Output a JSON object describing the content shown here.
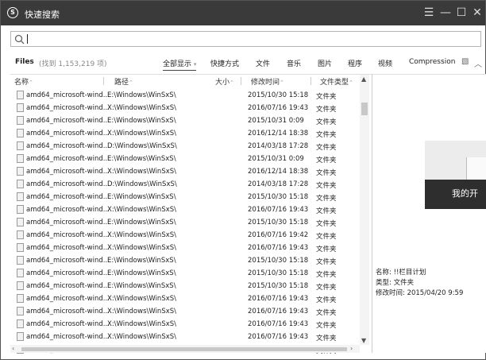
{
  "window": {
    "title": "快速搜索",
    "logo_glyph": "S",
    "menu_icon": "☰",
    "min_icon": "—",
    "max_icon": "☐",
    "close_icon": "✕"
  },
  "search": {
    "value": "",
    "placeholder": ""
  },
  "filters": {
    "files_label": "Files",
    "files_count": "(找到 1,153,219 项)",
    "items": [
      "全部显示",
      "快捷方式",
      "文件",
      "音乐",
      "图片",
      "程序",
      "视频",
      "Compression"
    ],
    "active": "全部显示",
    "active_arrow": "▾"
  },
  "table": {
    "headers": {
      "name": "名称",
      "path": "路径",
      "size": "大小",
      "date": "修改时间",
      "type": "文件类型"
    },
    "rows": [
      {
        "name": "amd64_microsoft-wind...",
        "path": "E:\\Windows\\WinSxS\\",
        "date": "2015/10/30 15:18",
        "type": "文件夹"
      },
      {
        "name": "amd64_microsoft-wind...",
        "path": "X:\\Windows\\WinSxS\\",
        "date": "2016/07/16 19:43",
        "type": "文件夹"
      },
      {
        "name": "amd64_microsoft-wind...",
        "path": "E:\\Windows\\WinSxS\\",
        "date": "2015/10/31 0:09",
        "type": "文件夹"
      },
      {
        "name": "amd64_microsoft-wind...",
        "path": "X:\\Windows\\WinSxS\\",
        "date": "2016/12/14 18:38",
        "type": "文件夹"
      },
      {
        "name": "amd64_microsoft-wind...",
        "path": "D:\\Windows\\WinSxS\\",
        "date": "2014/03/18 17:28",
        "type": "文件夹"
      },
      {
        "name": "amd64_microsoft-wind...",
        "path": "E:\\Windows\\WinSxS\\",
        "date": "2015/10/31 0:09",
        "type": "文件夹"
      },
      {
        "name": "amd64_microsoft-wind...",
        "path": "X:\\Windows\\WinSxS\\",
        "date": "2016/12/14 18:38",
        "type": "文件夹"
      },
      {
        "name": "amd64_microsoft-wind...",
        "path": "D:\\Windows\\WinSxS\\",
        "date": "2014/03/18 17:28",
        "type": "文件夹"
      },
      {
        "name": "amd64_microsoft-wind...",
        "path": "E:\\Windows\\WinSxS\\",
        "date": "2015/10/30 15:18",
        "type": "文件夹"
      },
      {
        "name": "amd64_microsoft-wind...",
        "path": "X:\\Windows\\WinSxS\\",
        "date": "2016/07/16 19:43",
        "type": "文件夹"
      },
      {
        "name": "amd64_microsoft-wind...",
        "path": "E:\\Windows\\WinSxS\\",
        "date": "2015/10/30 15:18",
        "type": "文件夹"
      },
      {
        "name": "amd64_microsoft-wind...",
        "path": "X:\\Windows\\WinSxS\\",
        "date": "2016/07/16 19:42",
        "type": "文件夹"
      },
      {
        "name": "amd64_microsoft-wind...",
        "path": "X:\\Windows\\WinSxS\\",
        "date": "2016/07/16 19:43",
        "type": "文件夹"
      },
      {
        "name": "amd64_microsoft-wind...",
        "path": "E:\\Windows\\WinSxS\\",
        "date": "2015/10/30 15:18",
        "type": "文件夹"
      },
      {
        "name": "amd64_microsoft-wind...",
        "path": "E:\\Windows\\WinSxS\\",
        "date": "2015/10/30 15:18",
        "type": "文件夹"
      },
      {
        "name": "amd64_microsoft-wind...",
        "path": "E:\\Windows\\WinSxS\\",
        "date": "2015/10/30 15:18",
        "type": "文件夹"
      },
      {
        "name": "amd64_microsoft-wind...",
        "path": "X:\\Windows\\WinSxS\\",
        "date": "2016/07/16 19:43",
        "type": "文件夹"
      },
      {
        "name": "amd64_microsoft-wind...",
        "path": "X:\\Windows\\WinSxS\\",
        "date": "2016/07/16 19:43",
        "type": "文件夹"
      },
      {
        "name": "amd64_microsoft-wind...",
        "path": "X:\\Windows\\WinSxS\\",
        "date": "2016/07/16 19:43",
        "type": "文件夹"
      },
      {
        "name": "amd64_microsoft-wind...",
        "path": "X:\\Windows\\WinSxS\\",
        "date": "2016/07/16 19:43",
        "type": "文件夹"
      },
      {
        "name": "amd64_microsoft-wind...",
        "path": "E:\\Windows\\WinSxS\\",
        "date": "2015/10/30 15:18",
        "type": "文件夹"
      }
    ]
  },
  "preview": {
    "thumb_text": "我的开",
    "name_label": "名称: !!栏目计划",
    "type_label": "类型: 文件夹",
    "date_label": "修改时间: 2015/04/20 9:59"
  }
}
